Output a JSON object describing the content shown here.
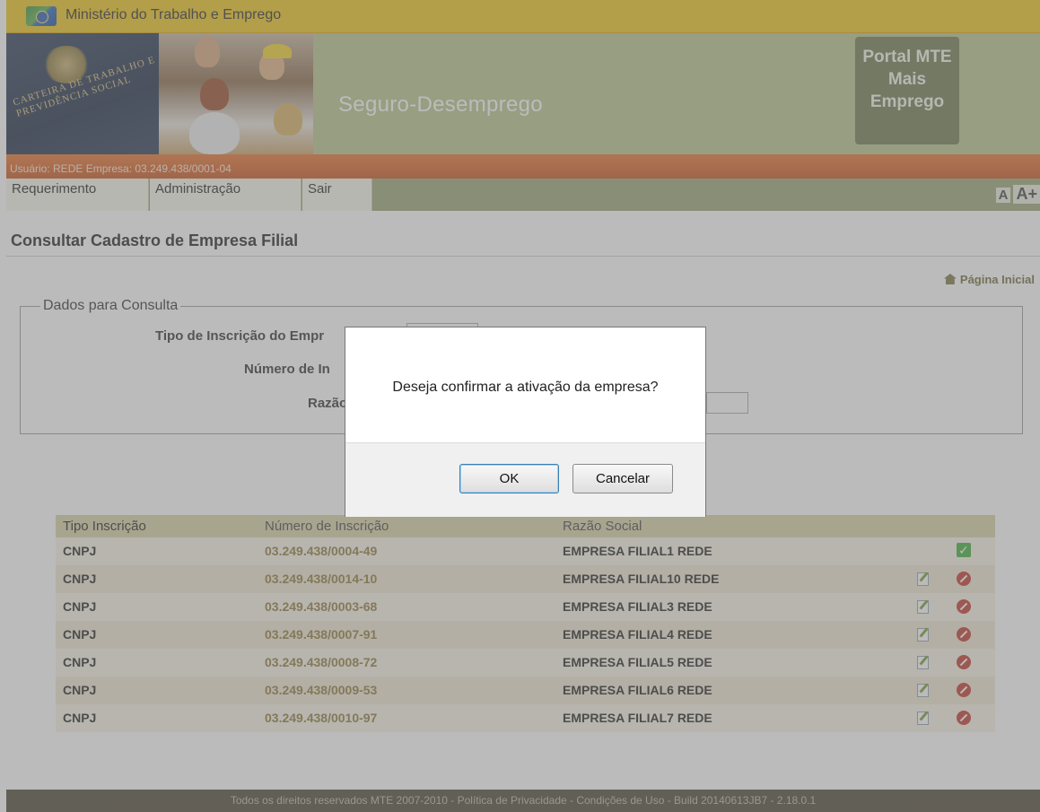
{
  "header": {
    "ministry": "Ministério do Trabalho e Emprego",
    "system_title": "Seguro-Desemprego",
    "card_text": "CARTEIRA DE TRABALHO E PREVIDÊNCIA SOCIAL",
    "portal_lines": [
      "Portal MTE",
      "Mais",
      "Emprego"
    ],
    "user_info": "Usuário: REDE Empresa: 03.249.438/0001-04"
  },
  "menu": {
    "items": [
      "Requerimento",
      "Administração",
      "Sair"
    ],
    "font_small": "A",
    "font_large": "A+"
  },
  "page": {
    "title": "Consultar Cadastro de Empresa Filial",
    "home_link": "Página Inicial"
  },
  "query": {
    "legend": "Dados para Consulta",
    "label_tipo": "Tipo de Inscrição do Empr",
    "label_numero": "Número de In",
    "label_razao": "Razão"
  },
  "table": {
    "headers": [
      "Tipo Inscrição",
      "Número de Inscrição",
      "Razão Social"
    ],
    "rows": [
      {
        "tipo": "CNPJ",
        "numero": "03.249.438/0004-49",
        "razao": "EMPRESA FILIAL1 REDE",
        "status": "active"
      },
      {
        "tipo": "CNPJ",
        "numero": "03.249.438/0014-10",
        "razao": "EMPRESA FILIAL10 REDE",
        "status": "inactive"
      },
      {
        "tipo": "CNPJ",
        "numero": "03.249.438/0003-68",
        "razao": "EMPRESA FILIAL3 REDE",
        "status": "inactive"
      },
      {
        "tipo": "CNPJ",
        "numero": "03.249.438/0007-91",
        "razao": "EMPRESA FILIAL4 REDE",
        "status": "inactive"
      },
      {
        "tipo": "CNPJ",
        "numero": "03.249.438/0008-72",
        "razao": "EMPRESA FILIAL5 REDE",
        "status": "inactive"
      },
      {
        "tipo": "CNPJ",
        "numero": "03.249.438/0009-53",
        "razao": "EMPRESA FILIAL6 REDE",
        "status": "inactive"
      },
      {
        "tipo": "CNPJ",
        "numero": "03.249.438/0010-97",
        "razao": "EMPRESA FILIAL7 REDE",
        "status": "inactive"
      }
    ]
  },
  "footer": {
    "text": "Todos os direitos reservados MTE 2007-2010 - Política de Privacidade - Condições de Uso - Build 20140613JB7 - 2.18.0.1"
  },
  "dialog": {
    "message": "Deseja confirmar a ativação da empresa?",
    "ok_label": "OK",
    "cancel_label": "Cancelar"
  },
  "icons": {
    "home": "home-icon",
    "edit": "edit-icon",
    "deny": "deny-icon",
    "check": "check-icon"
  },
  "colors": {
    "top_bar": "#eec41b",
    "banner": "#b7c48a",
    "user_bar": "#c8541c",
    "menu_bar": "#9aa477",
    "footer": "#4d4635"
  }
}
